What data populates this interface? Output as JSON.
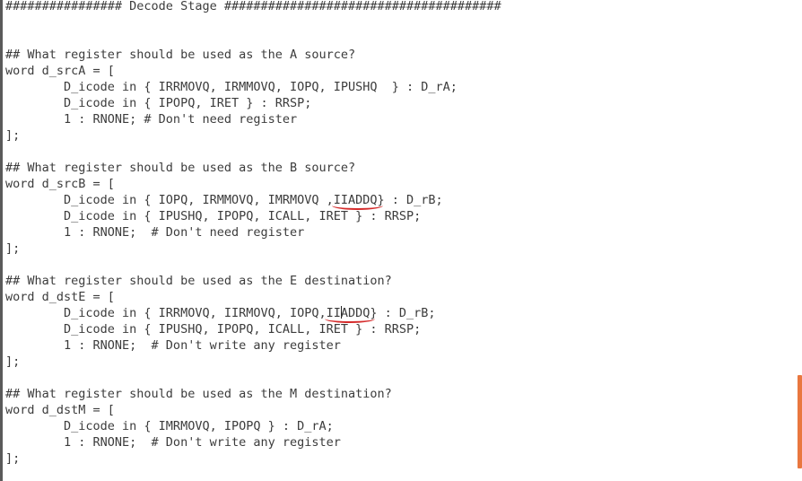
{
  "code": {
    "header": "################ Decode Stage ######################################",
    "srcA_comment": "## What register should be used as the A source?",
    "srcA_decl": "word d_srcA = [",
    "srcA_case1": "        D_icode in { IRRMOVQ, IRMMOVQ, IOPQ, IPUSHQ  } : D_rA;",
    "srcA_case2": "        D_icode in { IPOPQ, IRET } : RRSP;",
    "srcA_case3": "        1 : RNONE; # Don't need register",
    "srcA_close": "];",
    "srcB_comment": "## What register should be used as the B source?",
    "srcB_decl": "word d_srcB = [",
    "srcB_case1_pre": "        D_icode in { IOPQ, IRMMOVQ, IMRMOVQ ,",
    "srcB_case1_mark": "IIADDQ",
    "srcB_case1_post": "} : D_rB;",
    "srcB_case2": "        D_icode in { IPUSHQ, IPOPQ, ICALL, IRET } : RRSP;",
    "srcB_case3": "        1 : RNONE;  # Don't need register",
    "srcB_close": "];",
    "dstE_comment": "## What register should be used as the E destination?",
    "dstE_decl": "word d_dstE = [",
    "dstE_case1_pre": "        D_icode in { IRRMOVQ, IIRMOVQ, IOPQ,",
    "dstE_case1_mark_a": "II",
    "dstE_case1_mark_b": "ADDQ",
    "dstE_case1_post": "} : D_rB;",
    "dstE_case2": "        D_icode in { IPUSHQ, IPOPQ, ICALL, IRET } : RRSP;",
    "dstE_case3": "        1 : RNONE;  # Don't write any register",
    "dstE_close": "];",
    "dstM_comment": "## What register should be used as the M destination?",
    "dstM_decl": "word d_dstM = [",
    "dstM_case1": "        D_icode in { IMRMOVQ, IPOPQ } : D_rA;",
    "dstM_case2": "        1 : RNONE;  # Don't write any register",
    "dstM_close": "];"
  },
  "colors": {
    "text": "#3c3c3c",
    "background": "#ffffff",
    "underline_mark": "#d52b2b",
    "scrollbar_thumb": "#e9773f"
  }
}
